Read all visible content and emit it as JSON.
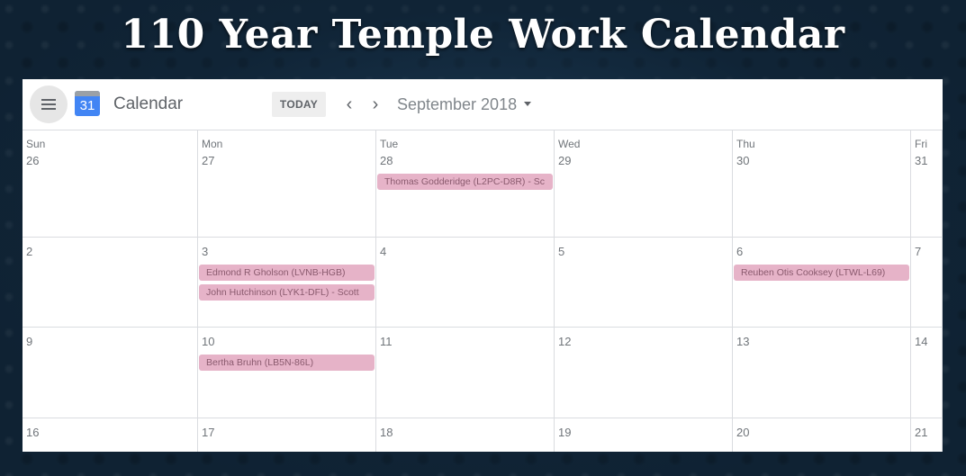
{
  "slide_title": "110 Year Temple Work Calendar",
  "topbar": {
    "app_name": "Calendar",
    "logo_number": "31",
    "today_label": "TODAY",
    "prev_icon": "‹",
    "next_icon": "›",
    "month_label": "September 2018"
  },
  "icons": {
    "menu": "hamburger-menu-icon",
    "logo": "calendar-logo-icon",
    "prev": "chevron-left-icon",
    "next": "chevron-right-icon",
    "dropdown": "caret-down-icon"
  },
  "colors": {
    "event_bg": "#e6b3c8",
    "event_text": "#8a5a6e",
    "logo_blue": "#4285f4"
  },
  "weekdays": [
    "Sun",
    "Mon",
    "Tue",
    "Wed",
    "Thu",
    "Fri"
  ],
  "weeks": [
    {
      "days": [
        {
          "num": "26",
          "events": []
        },
        {
          "num": "27",
          "events": []
        },
        {
          "num": "28",
          "events": [
            "Thomas Godderidge (L2PC-D8R) - Sc"
          ]
        },
        {
          "num": "29",
          "events": []
        },
        {
          "num": "30",
          "events": []
        },
        {
          "num": "31",
          "events": []
        }
      ]
    },
    {
      "days": [
        {
          "num": "2",
          "events": []
        },
        {
          "num": "3",
          "events": [
            "Edmond R Gholson (LVNB-HGB)",
            "John Hutchinson (LYK1-DFL) - Scott"
          ]
        },
        {
          "num": "4",
          "events": []
        },
        {
          "num": "5",
          "events": []
        },
        {
          "num": "6",
          "events": [
            "Reuben Otis Cooksey (LTWL-L69)"
          ]
        },
        {
          "num": "7",
          "events": []
        }
      ]
    },
    {
      "days": [
        {
          "num": "9",
          "events": []
        },
        {
          "num": "10",
          "events": [
            "Bertha Bruhn (LB5N-86L)"
          ]
        },
        {
          "num": "11",
          "events": []
        },
        {
          "num": "12",
          "events": []
        },
        {
          "num": "13",
          "events": []
        },
        {
          "num": "14",
          "events": []
        }
      ]
    },
    {
      "days": [
        {
          "num": "16",
          "events": []
        },
        {
          "num": "17",
          "events": []
        },
        {
          "num": "18",
          "events": []
        },
        {
          "num": "19",
          "events": []
        },
        {
          "num": "20",
          "events": []
        },
        {
          "num": "21",
          "events": []
        }
      ]
    }
  ]
}
